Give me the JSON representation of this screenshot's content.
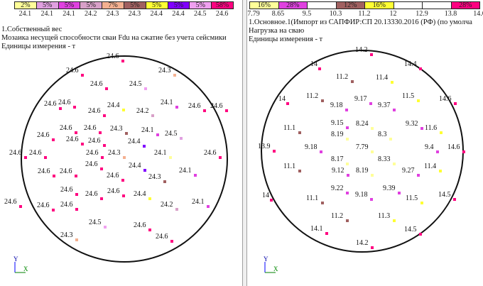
{
  "left": {
    "legend": {
      "cells": [
        {
          "pct": "2%",
          "color": "#ffff99"
        },
        {
          "pct": "5%",
          "color": "#e0a0e0"
        },
        {
          "pct": "5%",
          "color": "#e040e0"
        },
        {
          "pct": "5%",
          "color": "#d8a0c8"
        },
        {
          "pct": "7%",
          "color": "#f4b090"
        },
        {
          "pct": "5%",
          "color": "#a06060"
        },
        {
          "pct": "5%",
          "color": "#ffff33"
        },
        {
          "pct": "5%",
          "color": "#8000ff"
        },
        {
          "pct": "5%",
          "color": "#f0a0f0"
        },
        {
          "pct": "58%",
          "color": "#ff0080"
        }
      ],
      "values": [
        "24.1",
        "24.1",
        "24.1",
        "24.2",
        "24.3",
        "24.3",
        "24.4",
        "24.4",
        "24.5",
        "24.6"
      ]
    },
    "header": {
      "line1": "1.Собственный вес",
      "line2": "Мозаика несущей способности сваи Fdu на сжатие без учета сейсмики",
      "line3": "Единицы измерения - т"
    },
    "piles": [
      {
        "v": "24.6",
        "c": "#ff0080"
      },
      {
        "v": "24.6",
        "c": "#ff0080"
      },
      {
        "v": "24.3",
        "c": "#f4b090"
      },
      {
        "v": "24.6",
        "c": "#ff0080"
      },
      {
        "v": "24.5",
        "c": "#f0a0f0"
      },
      {
        "v": "24.6",
        "c": "#ff0080"
      },
      {
        "v": "24.6",
        "c": "#ff0080"
      },
      {
        "v": "24.6",
        "c": "#ff0080"
      },
      {
        "v": "24.4",
        "c": "#ffff33"
      },
      {
        "v": "24.2",
        "c": "#d8a0c8"
      },
      {
        "v": "24.1",
        "c": "#e040e0"
      },
      {
        "v": "24.6",
        "c": "#ff0080"
      },
      {
        "v": "24.6",
        "c": "#ff0080"
      },
      {
        "v": "24.6",
        "c": "#ff0080"
      },
      {
        "v": "24.6",
        "c": "#ff0080"
      },
      {
        "v": "24.6",
        "c": "#ff0080"
      },
      {
        "v": "24.3",
        "c": "#a06060"
      },
      {
        "v": "24.1",
        "c": "#e040e0"
      },
      {
        "v": "24.6",
        "c": "#ff0080"
      },
      {
        "v": "24.6",
        "c": "#ff0080"
      },
      {
        "v": "24.4",
        "c": "#8000ff"
      },
      {
        "v": "24.5",
        "c": "#e0a0e0"
      },
      {
        "v": "24.6",
        "c": "#ff0080"
      },
      {
        "v": "24.6",
        "c": "#ff0080"
      },
      {
        "v": "24.6",
        "c": "#ff0080"
      },
      {
        "v": "24.3",
        "c": "#f4b090"
      },
      {
        "v": "24.1",
        "c": "#ffff99"
      },
      {
        "v": "24.6",
        "c": "#ff0080"
      },
      {
        "v": "24.6",
        "c": "#ff0080"
      },
      {
        "v": "24.4",
        "c": "#8000ff"
      },
      {
        "v": "24.1",
        "c": "#e040e0"
      },
      {
        "v": "24.6",
        "c": "#ff0080"
      },
      {
        "v": "24.6",
        "c": "#ff0080"
      },
      {
        "v": "24.6",
        "c": "#ff0080"
      },
      {
        "v": "24.3",
        "c": "#a06060"
      },
      {
        "v": "24.6",
        "c": "#ff0080"
      },
      {
        "v": "24.6",
        "c": "#ff0080"
      },
      {
        "v": "24.6",
        "c": "#ff0080"
      },
      {
        "v": "24.4",
        "c": "#ffff33"
      },
      {
        "v": "24.2",
        "c": "#d8a0c8"
      },
      {
        "v": "24.1",
        "c": "#e040e0"
      },
      {
        "v": "24.6",
        "c": "#ff0080"
      },
      {
        "v": "24.6",
        "c": "#ff0080"
      },
      {
        "v": "24.6",
        "c": "#ff0080"
      },
      {
        "v": "24.5",
        "c": "#f0a0f0"
      },
      {
        "v": "24.6",
        "c": "#ff0080"
      },
      {
        "v": "24.3",
        "c": "#f4b090"
      },
      {
        "v": "24.6",
        "c": "#ff0080"
      }
    ]
  },
  "right": {
    "legend": {
      "cells": [
        {
          "pct": "16%",
          "color": "#ffff99"
        },
        {
          "pct": "28%",
          "color": "#e040e0"
        },
        {
          "pct": "",
          "color": "#ffffff"
        },
        {
          "pct": "12%",
          "color": "#a06060"
        },
        {
          "pct": "16%",
          "color": "#ffff33"
        },
        {
          "pct": "",
          "color": "#ffffff"
        },
        {
          "pct": "",
          "color": "#ffffff"
        },
        {
          "pct": "28%",
          "color": "#ff0080"
        }
      ],
      "values": [
        "7.79",
        "8.65",
        "9.5",
        "10.3",
        "11.2",
        "12",
        "12.9",
        "13.8",
        "14.6"
      ]
    },
    "header": {
      "line1": "1.Основное.1(Импорт из САПФИР:СП 20.13330.2016 (РФ) (по умолча",
      "line2": "Нагрузка на сваю",
      "line3": "Единицы измерения - т"
    },
    "piles": [
      {
        "v": "14.2",
        "c": "#ff0080"
      },
      {
        "v": "14",
        "c": "#ff0080"
      },
      {
        "v": "14.4",
        "c": "#ff0080"
      },
      {
        "v": "11.2",
        "c": "#a06060"
      },
      {
        "v": "11.4",
        "c": "#ffff33"
      },
      {
        "v": "11.2",
        "c": "#a06060"
      },
      {
        "v": "9.17",
        "c": "#e040e0"
      },
      {
        "v": "11.5",
        "c": "#ffff33"
      },
      {
        "v": "14",
        "c": "#ff0080"
      },
      {
        "v": "9.18",
        "c": "#e040e0"
      },
      {
        "v": "9.37",
        "c": "#e040e0"
      },
      {
        "v": "14.6",
        "c": "#ff0080"
      },
      {
        "v": "11.1",
        "c": "#a06060"
      },
      {
        "v": "9.15",
        "c": "#e040e0"
      },
      {
        "v": "8.24",
        "c": "#ffff99"
      },
      {
        "v": "9.32",
        "c": "#e040e0"
      },
      {
        "v": "11.6",
        "c": "#ffff33"
      },
      {
        "v": "8.19",
        "c": "#ffff99"
      },
      {
        "v": "8.3",
        "c": "#ffff99"
      },
      {
        "v": "13.9",
        "c": "#ff0080"
      },
      {
        "v": "9.18",
        "c": "#e040e0"
      },
      {
        "v": "7.79",
        "c": "#ffff99"
      },
      {
        "v": "9.4",
        "c": "#e040e0"
      },
      {
        "v": "14.6",
        "c": "#ff0080"
      },
      {
        "v": "8.17",
        "c": "#ffff99"
      },
      {
        "v": "8.33",
        "c": "#ffff99"
      },
      {
        "v": "11.1",
        "c": "#a06060"
      },
      {
        "v": "9.12",
        "c": "#e040e0"
      },
      {
        "v": "8.19",
        "c": "#ffff99"
      },
      {
        "v": "9.27",
        "c": "#e040e0"
      },
      {
        "v": "11.4",
        "c": "#ffff33"
      },
      {
        "v": "9.22",
        "c": "#e040e0"
      },
      {
        "v": "9.39",
        "c": "#e040e0"
      },
      {
        "v": "14",
        "c": "#ff0080"
      },
      {
        "v": "11.1",
        "c": "#a06060"
      },
      {
        "v": "9.18",
        "c": "#e040e0"
      },
      {
        "v": "11.5",
        "c": "#ffff33"
      },
      {
        "v": "14.5",
        "c": "#ff0080"
      },
      {
        "v": "11.2",
        "c": "#a06060"
      },
      {
        "v": "11.3",
        "c": "#ffff33"
      },
      {
        "v": "14.1",
        "c": "#ff0080"
      },
      {
        "v": "14.5",
        "c": "#ff0080"
      },
      {
        "v": "14.2",
        "c": "#ff0080"
      }
    ]
  },
  "axes": {
    "y": "Y",
    "x": "X"
  }
}
